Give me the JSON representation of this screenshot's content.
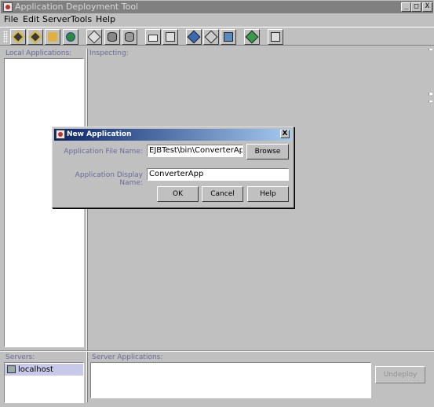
{
  "window": {
    "title": "Application Deployment Tool",
    "minimize": "_",
    "maximize": "□",
    "close": "X"
  },
  "menu": [
    "File",
    "Edit",
    "Server",
    "Tools",
    "Help"
  ],
  "toolbar": {
    "icons": [
      "new-application-icon",
      "new-component-icon",
      "open-icon",
      "globe-icon",
      "add-icon",
      "database-icon",
      "deploy-db-icon",
      "folder-icon",
      "save-icon",
      "edit-icon",
      "edit-properties-icon",
      "back-icon",
      "verify-icon",
      "copy-icon"
    ]
  },
  "labels": {
    "local_applications": "Local Applications:",
    "inspecting": "Inspecting:",
    "servers": "Servers:",
    "server_applications": "Server Applications:"
  },
  "servers": [
    {
      "name": "localhost"
    }
  ],
  "buttons": {
    "undeploy": "Undeploy"
  },
  "dialog": {
    "title": "New Application",
    "close": "X",
    "file_label": "Application File Name:",
    "file_value": "EJBTest\\bin\\ConverterApp.ear",
    "browse": "Browse",
    "display_label": "Application Display Name:",
    "display_value": "ConverterApp",
    "ok": "OK",
    "cancel": "Cancel",
    "help": "Help"
  },
  "colors": {
    "accent": "#0a246a",
    "label": "#6a6a9a",
    "selected_row": "#c8c8e8"
  }
}
